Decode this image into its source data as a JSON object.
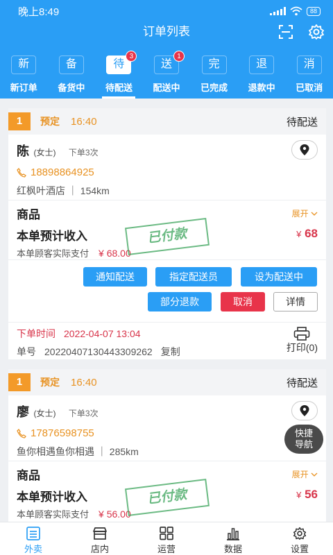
{
  "status_bar": {
    "time": "晚上8:49",
    "battery": "88"
  },
  "header": {
    "title": "订单列表"
  },
  "tabs": [
    {
      "icon_char": "新",
      "label": "新订单",
      "badge": ""
    },
    {
      "icon_char": "备",
      "label": "备货中",
      "badge": ""
    },
    {
      "icon_char": "待",
      "label": "待配送",
      "badge": "3"
    },
    {
      "icon_char": "送",
      "label": "配送中",
      "badge": "1"
    },
    {
      "icon_char": "完",
      "label": "已完成",
      "badge": ""
    },
    {
      "icon_char": "退",
      "label": "退款中",
      "badge": ""
    },
    {
      "icon_char": "消",
      "label": "已取消",
      "badge": ""
    }
  ],
  "orders": [
    {
      "index": "1",
      "booking": "预定",
      "time": "16:40",
      "status": "待配送",
      "customer_name": "陈",
      "customer_title": "(女士)",
      "order_count": "下单3次",
      "phone": "18898864925",
      "address": "红枫叶酒店 ｜ 154km",
      "goods_label": "商品",
      "expand_label": "展开",
      "income_label": "本单预计收入",
      "income_currency": "¥",
      "income_value": "68",
      "paid_label": "本单顾客实际支付",
      "paid_value": "¥ 68.00",
      "stamp_text": "已付款",
      "buttons": {
        "notify": "通知配送",
        "assign": "指定配送员",
        "set_delivering": "设为配送中",
        "partial_refund": "部分退款",
        "cancel": "取消",
        "detail": "详情"
      },
      "order_time_label": "下单时间",
      "order_time": "2022-04-07 13:04",
      "order_no_label": "单号",
      "order_no": "20220407130443309262",
      "copy_label": "复制",
      "print_label": "打印(0)"
    },
    {
      "index": "1",
      "booking": "预定",
      "time": "16:40",
      "status": "待配送",
      "customer_name": "廖",
      "customer_title": "(女士)",
      "order_count": "下单3次",
      "phone": "17876598755",
      "address": "鱼你相遇鱼你相遇 ｜ 285km",
      "goods_label": "商品",
      "expand_label": "展开",
      "income_label": "本单预计收入",
      "income_currency": "¥",
      "income_value": "56",
      "paid_label": "本单顾客实际支付",
      "paid_value": "¥ 56.00",
      "stamp_text": "已付款"
    }
  ],
  "nav_fab": {
    "line1": "快捷",
    "line2": "导航"
  },
  "bottom_nav": [
    {
      "label": "外卖",
      "icon": "list-icon"
    },
    {
      "label": "店内",
      "icon": "store-icon"
    },
    {
      "label": "运营",
      "icon": "grid-icon"
    },
    {
      "label": "数据",
      "icon": "bar-chart-icon"
    },
    {
      "label": "设置",
      "icon": "gear-icon"
    }
  ],
  "colors": {
    "primary": "#2a9ef5",
    "accent_orange": "#e89222",
    "alert_red": "#e8344a",
    "paid_green": "#3aa35a"
  }
}
